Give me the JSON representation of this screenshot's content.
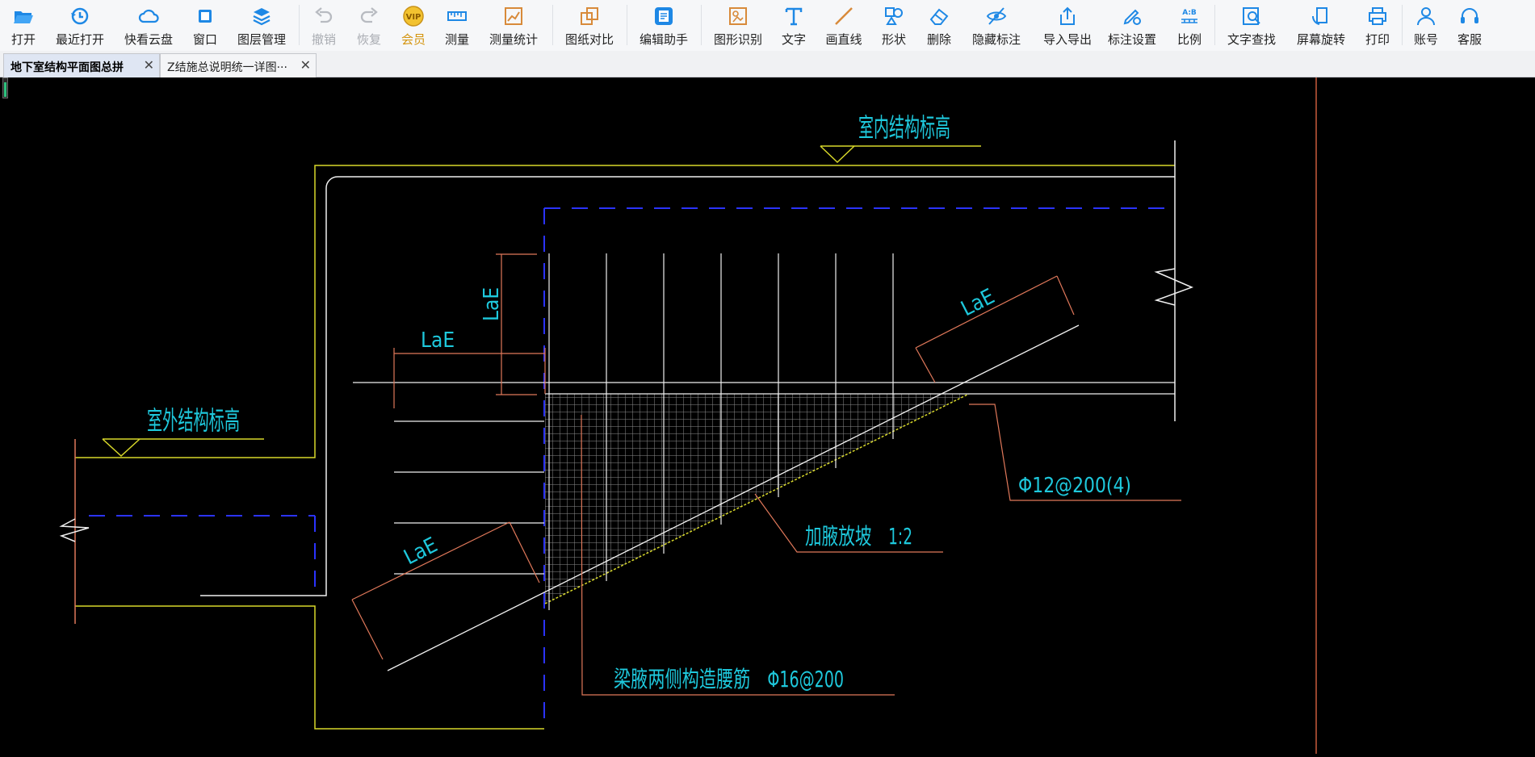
{
  "toolbar": {
    "items": [
      {
        "label": "打开",
        "icon": "folder-open-icon"
      },
      {
        "label": "最近打开",
        "icon": "history-clock-icon"
      },
      {
        "label": "快看云盘",
        "icon": "cloud-icon"
      },
      {
        "label": "窗口",
        "icon": "window-icon"
      },
      {
        "label": "图层管理",
        "icon": "layers-icon"
      },
      {
        "label": "撤销",
        "icon": "undo-icon"
      },
      {
        "label": "恢复",
        "icon": "redo-icon"
      },
      {
        "label": "会员",
        "icon": "vip-icon"
      },
      {
        "label": "测量",
        "icon": "ruler-icon"
      },
      {
        "label": "测量统计",
        "icon": "measure-stats-icon"
      },
      {
        "label": "图纸对比",
        "icon": "compare-icon"
      },
      {
        "label": "编辑助手",
        "icon": "edit-assistant-icon"
      },
      {
        "label": "图形识别",
        "icon": "shape-recognition-icon"
      },
      {
        "label": "文字",
        "icon": "text-icon"
      },
      {
        "label": "画直线",
        "icon": "line-icon"
      },
      {
        "label": "形状",
        "icon": "shapes-icon"
      },
      {
        "label": "删除",
        "icon": "eraser-icon"
      },
      {
        "label": "隐藏标注",
        "icon": "hide-eye-icon"
      },
      {
        "label": "导入导出",
        "icon": "import-export-icon"
      },
      {
        "label": "标注设置",
        "icon": "annotation-settings-icon"
      },
      {
        "label": "比例",
        "icon": "scale-icon"
      },
      {
        "label": "文字查找",
        "icon": "text-search-icon"
      },
      {
        "label": "屏幕旋转",
        "icon": "rotate-screen-icon"
      },
      {
        "label": "打印",
        "icon": "printer-icon"
      },
      {
        "label": "账号",
        "icon": "user-icon"
      },
      {
        "label": "客服",
        "icon": "headset-icon"
      }
    ],
    "vip_badge": "VIP",
    "scale_badge_top": "A:B"
  },
  "tabs": [
    {
      "label": "地下室结构平面图总拼",
      "active": true
    },
    {
      "label": "Z结施总说明统一详图···",
      "active": false
    }
  ],
  "drawing": {
    "labels": {
      "indoor_elevation": "室内结构标高",
      "outdoor_elevation": "室外结构标高",
      "lae_vertical": "LaE",
      "lae_left": "LaE",
      "lae_right_top": "LaE",
      "lae_bottom_left": "LaE",
      "rebar_stirrup": "Φ12@200(4)",
      "haunch_slope": "加腋放坡　1:2",
      "waist_rebar": "梁腋两侧构造腰筋　Φ16@200"
    },
    "colors": {
      "background": "#000000",
      "yellow": "#d8d82a",
      "white": "#f0f0f0",
      "cyan": "#1ec8dc",
      "orange": "#e0785a",
      "blue_dash": "#2b33ff",
      "grey_hatch": "#9a9a9a",
      "red_line": "#c85a3c"
    }
  },
  "progress_indicator": 0.8
}
